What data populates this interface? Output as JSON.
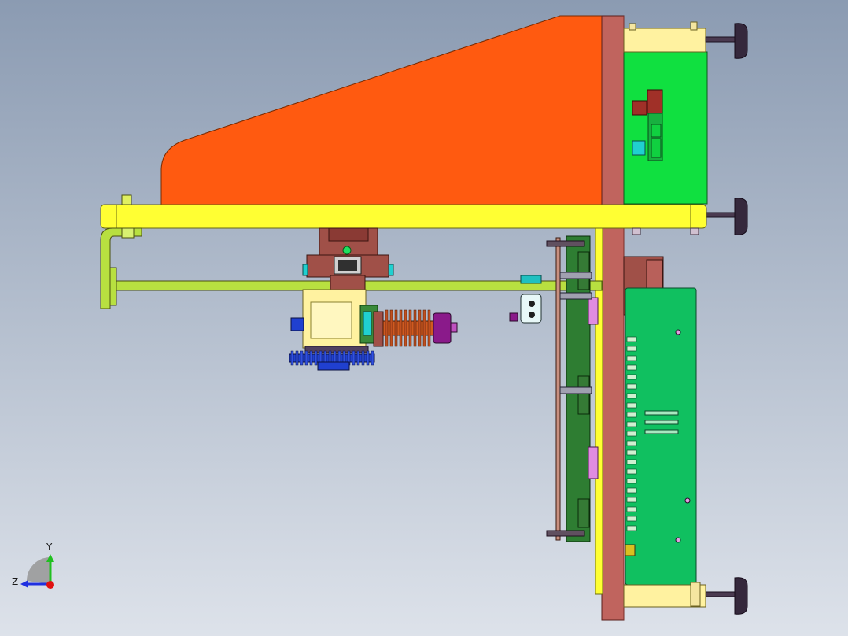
{
  "viewport": {
    "background_top": "#8b9bb2",
    "background_bottom": "#dde2ea"
  },
  "colors": {
    "orange_guard": "#ff5a10",
    "yellow_beam": "#ffff33",
    "maroon_plate": "#c0645e",
    "green_pcb": "#10e040",
    "green_board": "#10c060",
    "dark_green": "#2e7d32",
    "cream_block": "#fff2a0",
    "brown_motor": "#a05048",
    "copper_spring": "#d05a20",
    "purple_cap": "#8a1a8a",
    "blue_gear": "#2040d0",
    "cyan_part": "#20d0d0",
    "rod_green": "#b8e040",
    "foot_dark": "#35283c",
    "pink_part": "#e08ce0"
  },
  "triad": {
    "y_label": "Y",
    "z_label": "Z",
    "y_axis_color": "#20c020",
    "z_axis_color": "#2030e0",
    "origin_color": "#e01010"
  }
}
